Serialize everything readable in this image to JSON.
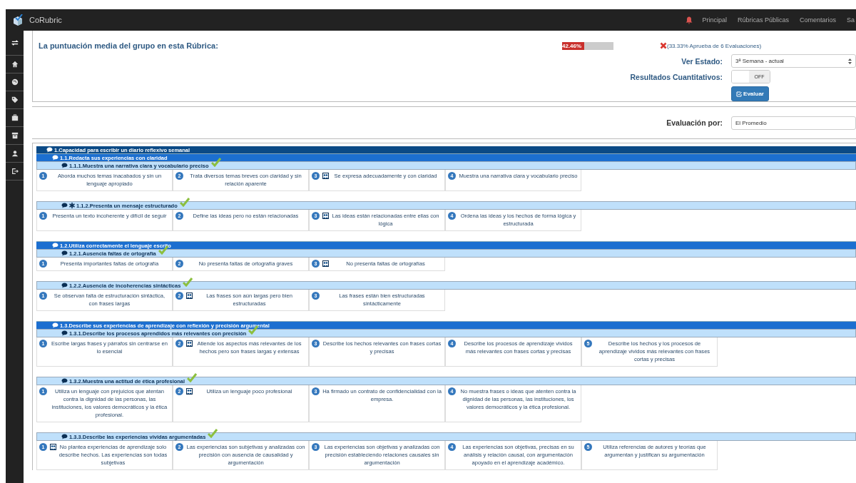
{
  "nav": {
    "brand": "CoRubric",
    "links": [
      "Principal",
      "Rúbricas Públicas",
      "Comentarios",
      "Sa"
    ]
  },
  "summary": {
    "label": "La puntuación media del grupo en esta Rúbrica:",
    "score": "42.46%",
    "level": 0.4246,
    "passed": false,
    "approval": "(33.33% Aprueba de 6 Evaluaciones)"
  },
  "ver_estado": {
    "label": "Ver Estado:",
    "value": "3ª Semana - actual"
  },
  "quantitative": {
    "label": "Resultados Cuantitativos:",
    "on": false,
    "state_text": "OFF"
  },
  "evaluate_button": "Evaluar",
  "evaluacion_por": {
    "label": "Evaluación por:",
    "value": "El Promedio"
  },
  "rubric": [
    {
      "title": "1.Capacidad para escribir un diario reflexivo semanal",
      "children": [
        {
          "title": "1.1.Redacta sus experiencias con claridad",
          "criteria": [
            {
              "title": "1.1.1.Muestra una narrativa clara y vocabulario preciso",
              "starred": false,
              "checked": true,
              "levels": [
                {
                  "number": "1",
                  "text": "Aborda muchos temas inacabados y sin un lenguaje apropiado",
                  "selected": false
                },
                {
                  "number": "2",
                  "text": "Trata diversos temas breves con claridad y sin relación aparente",
                  "selected": false
                },
                {
                  "number": "3",
                  "text": "Se expresa adecuadamente y con claridad",
                  "selected": true
                },
                {
                  "number": "4",
                  "text": "Muestra una narrativa clara y vocabulario preciso",
                  "selected": false
                }
              ]
            },
            {
              "title": "1.1.2.Presenta un mensaje estructurado",
              "starred": true,
              "checked": true,
              "levels": [
                {
                  "number": "1",
                  "text": "Presenta un texto incoherente y difícil de seguir",
                  "selected": false
                },
                {
                  "number": "2",
                  "text": "Define las ideas pero no están relacionadas",
                  "selected": false
                },
                {
                  "number": "3",
                  "text": "Las ideas están relacionadas entre ellas con lógica",
                  "selected": true
                },
                {
                  "number": "4",
                  "text": "Ordena las ideas y los hechos de forma lógica y estructurada",
                  "selected": false
                }
              ]
            }
          ]
        },
        {
          "title": "1.2.Utiliza correctamente el lenguaje escrito",
          "criteria": [
            {
              "title": "1.2.1.Ausencia faltas de ortografía",
              "starred": false,
              "checked": true,
              "levels": [
                {
                  "number": "1",
                  "text": "Presenta importantes faltas de ortografía",
                  "selected": false
                },
                {
                  "number": "2",
                  "text": "No presenta faltas de ortografía graves",
                  "selected": false
                },
                {
                  "number": "3",
                  "text": "No presenta faltas de ortografías",
                  "selected": true
                }
              ]
            },
            {
              "title": "1.2.2.Ausencia de incoherencias sintácticas",
              "starred": false,
              "checked": true,
              "levels": [
                {
                  "number": "1",
                  "text": "Se observan falta de estructuración sintáctica, con frases largas",
                  "selected": false
                },
                {
                  "number": "2",
                  "text": "Las frases son aún largas pero bien estructuradas",
                  "selected": true
                },
                {
                  "number": "3",
                  "text": "Las frases están bien estructuradas sintácticamente",
                  "selected": false
                }
              ]
            }
          ]
        },
        {
          "title": "1.3.Describe sus experiencias de aprendizaje con reflexión y precisión argumental",
          "criteria": [
            {
              "title": "1.3.1.Describe los procesos aprendidos más relevantes con precisión",
              "starred": false,
              "checked": true,
              "levels": [
                {
                  "number": "1",
                  "text": "Escribe largas frases y párrafos sin centrarse en lo esencial",
                  "selected": false
                },
                {
                  "number": "2",
                  "text": "Atiende los aspectos más relevantes de los hechos pero son frases largas y extensas",
                  "selected": true
                },
                {
                  "number": "3",
                  "text": "Describe los hechos relevantes con frases cortas y precisas",
                  "selected": false
                },
                {
                  "number": "4",
                  "text": "Describe los procesos de aprendizaje vividos más relevantes con frases cortas y precisas",
                  "selected": false
                },
                {
                  "number": "5",
                  "text": "Describe los hechos y los procesos de aprendizaje vividos más relevantes con frases cortas y precisas",
                  "selected": false
                }
              ]
            },
            {
              "title": "1.3.2.Muestra una actitud de ética profesional",
              "starred": false,
              "checked": true,
              "levels": [
                {
                  "number": "1",
                  "text": "Utiliza un lenguaje con prejuicios que atentan contra la dignidad de las personas, las instituciones, los valores democráticos y la ética profesional.",
                  "selected": false
                },
                {
                  "number": "2",
                  "text": "Utiliza un lenguaje poco profesional",
                  "selected": true
                },
                {
                  "number": "3",
                  "text": "Ha firmado un contrato de confidencialidad con la empresa.",
                  "selected": false
                },
                {
                  "number": "4",
                  "text": "No muestra frases o ideas que atenten contra la dignidad de las personas, las instituciones, los valores democráticos y la ética profesional.",
                  "selected": false
                }
              ]
            },
            {
              "title": "1.3.3.Describe las experiencias vividas argumentadas",
              "starred": false,
              "checked": true,
              "levels": [
                {
                  "number": "1",
                  "text": "No plantea experiencias de aprendizaje solo describe hechos. Las experiencias son todas subjetivas",
                  "selected": true
                },
                {
                  "number": "2",
                  "text": "Las experiencias son subjetivas y analizadas con precisión con ausencia de causalidad y argumentación",
                  "selected": false
                },
                {
                  "number": "3",
                  "text": "Las experiencias son objetivas y analizadas con precisión estableciendo relaciones causales sin argumentación",
                  "selected": false
                },
                {
                  "number": "4",
                  "text": "Las experiencias son objetivas, precisas en su análisis y relación causal, con argumentación apoyado en el aprendizaje académico.",
                  "selected": false
                },
                {
                  "number": "5",
                  "text": "Utiliza referencias de autores y teorías que argumentan y justifican su argumentación",
                  "selected": false
                }
              ]
            }
          ]
        }
      ]
    }
  ]
}
